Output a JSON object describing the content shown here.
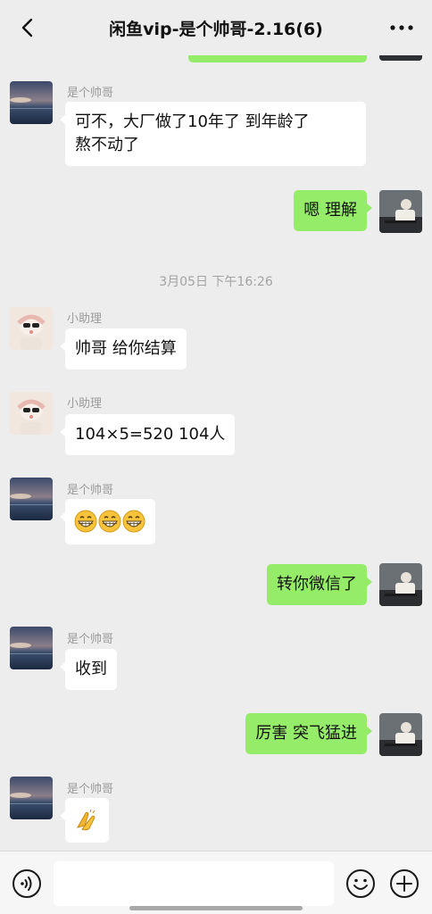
{
  "header": {
    "title": "闲鱼vip-是个帅哥-2.16(6)",
    "back_icon": "chevron-left-icon",
    "more_icon": "more-dots-icon"
  },
  "messages": [
    {
      "side": "left",
      "sender": "是个帅哥",
      "text": "可不，大厂做了10年了  到年龄了\n熬不动了",
      "lines": [
        "可不，大厂做了10年了  到年龄了",
        "熬不动了"
      ]
    },
    {
      "side": "right",
      "text": "嗯 理解"
    },
    {
      "timestamp": "3月05日 下午16:26"
    },
    {
      "side": "left",
      "sender": "小助理",
      "text": "帅哥  给你结算"
    },
    {
      "side": "left",
      "sender": "小助理",
      "text": "104×5=520   104人"
    },
    {
      "side": "left",
      "sender": "是个帅哥",
      "emoji": "grinning-face-emoji x3"
    },
    {
      "side": "right",
      "text": "转你微信了"
    },
    {
      "side": "left",
      "sender": "是个帅哥",
      "text": "收到"
    },
    {
      "side": "right",
      "text": "厉害 突飞猛进"
    },
    {
      "side": "left",
      "sender": "是个帅哥",
      "emoji": "clapping-hands-emoji"
    }
  ],
  "input_bar": {
    "voice_icon": "voice-icon",
    "emoji_icon": "emoji-icon",
    "plus_icon": "plus-icon",
    "input_value": ""
  },
  "colors": {
    "background": "#ededed",
    "my_bubble": "#95ec69",
    "their_bubble": "#ffffff",
    "sender_name": "#9a9a9a"
  }
}
